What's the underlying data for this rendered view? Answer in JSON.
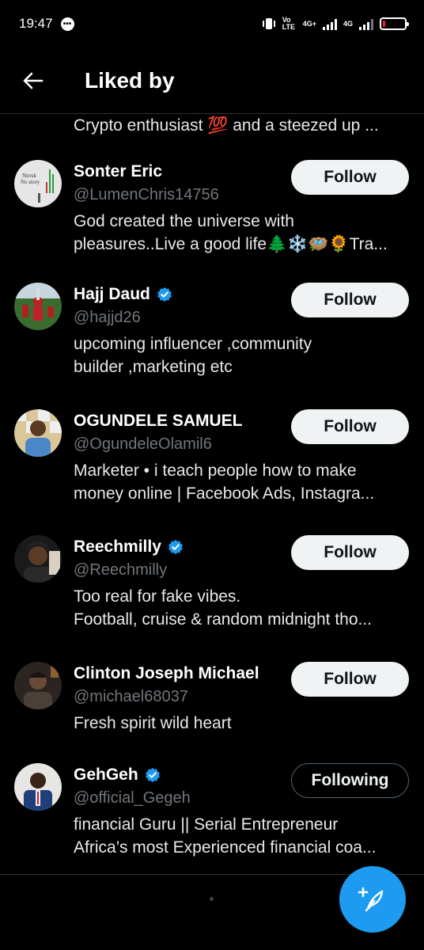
{
  "status_bar": {
    "time": "19:47",
    "network1": "Vo LTE",
    "network2": "4G+",
    "network3": "4G",
    "battery_level_fraction": 0.12,
    "battery_color": "#f4212e"
  },
  "header": {
    "title": "Liked by"
  },
  "partial_user": {
    "bio": "Crypto enthusiast 💯 and a steezed up ..."
  },
  "users": [
    {
      "name": "Sonter Eric",
      "handle": "@LumenChris14756",
      "verified": false,
      "bio_line1": "God created the universe with",
      "bio_line2": "pleasures..Live a good life🌲❄️🪺🌻Tra...",
      "button": "Follow"
    },
    {
      "name": "Hajj Daud",
      "handle": "@hajjd26",
      "verified": true,
      "bio_line1": "upcoming influencer ,community",
      "bio_line2": "builder ,marketing etc",
      "button": "Follow"
    },
    {
      "name": "OGUNDELE SAMUEL",
      "handle": "@OgundeleOlamil6",
      "verified": false,
      "bio_line1": "Marketer • i teach people how to make",
      "bio_line2": "money online | Facebook Ads, Instagra...",
      "button": "Follow"
    },
    {
      "name": "Reechmilly",
      "handle": "@Reechmilly",
      "verified": true,
      "bio_line1": "Too real for fake vibes.",
      "bio_line2": "Football, cruise & random midnight tho...",
      "button": "Follow"
    },
    {
      "name": "Clinton Joseph Michael",
      "handle": "@michael68037",
      "verified": false,
      "bio_line1": "Fresh spirit wild heart",
      "bio_line2": "",
      "button": "Follow"
    },
    {
      "name": "GehGeh",
      "handle": "@official_Gegeh",
      "verified": true,
      "bio_line1": "financial Guru || Serial Entrepreneur",
      "bio_line2": "Africa’s most Experienced financial coa...",
      "button": "Following"
    }
  ],
  "colors": {
    "accent": "#1d9bf0",
    "background": "#000000",
    "secondary_text": "#71767b"
  },
  "icons": {
    "back": "arrow-left-icon",
    "verified": "verified-badge-icon",
    "compose": "compose-post-icon"
  }
}
